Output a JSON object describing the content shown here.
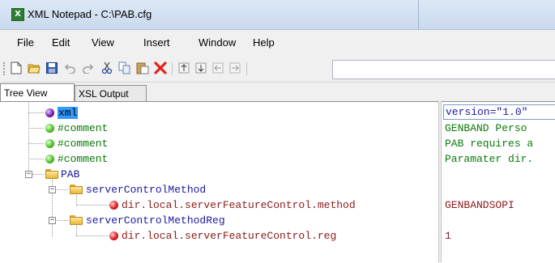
{
  "window": {
    "title": "XML Notepad - C:\\PAB.cfg",
    "app_icon": "xml-notepad-icon"
  },
  "menu": {
    "items": [
      "File",
      "Edit",
      "View",
      "Insert",
      "Window",
      "Help"
    ]
  },
  "toolbar": {
    "buttons": [
      "new-icon",
      "open-icon",
      "save-icon",
      "undo-icon",
      "redo-icon",
      "cut-icon",
      "copy-icon",
      "paste-icon",
      "delete-icon",
      "nudge-up-icon",
      "nudge-down-icon",
      "nudge-left-icon",
      "nudge-right-icon"
    ],
    "path_value": ""
  },
  "tabs": {
    "items": [
      "Tree View",
      "XSL Output"
    ],
    "active": "Tree View"
  },
  "tree": {
    "nodes": [
      {
        "label": "xml",
        "kind": "processing-instruction",
        "selected": true
      },
      {
        "label": "#comment",
        "kind": "comment"
      },
      {
        "label": "#comment",
        "kind": "comment"
      },
      {
        "label": "#comment",
        "kind": "comment"
      },
      {
        "label": "PAB",
        "kind": "element",
        "expanded": true
      },
      {
        "label": "serverControlMethod",
        "kind": "element",
        "expanded": true
      },
      {
        "label": "dir.local.serverFeatureControl.method",
        "kind": "attribute"
      },
      {
        "label": "serverControlMethodReg",
        "kind": "element",
        "expanded": true
      },
      {
        "label": "dir.local.serverFeatureControl.reg",
        "kind": "attribute"
      }
    ]
  },
  "values": {
    "rows": [
      "version=\"1.0\" ",
      "GENBAND  Perso",
      "PAB requires a",
      "Paramater dir.",
      "",
      "",
      "GENBANDSOPI",
      "",
      "1"
    ]
  },
  "colors": {
    "comment": "#0a7a0a",
    "element": "#1a1aa0",
    "attribute": "#8b1a1a",
    "selection": "#3399ff"
  }
}
